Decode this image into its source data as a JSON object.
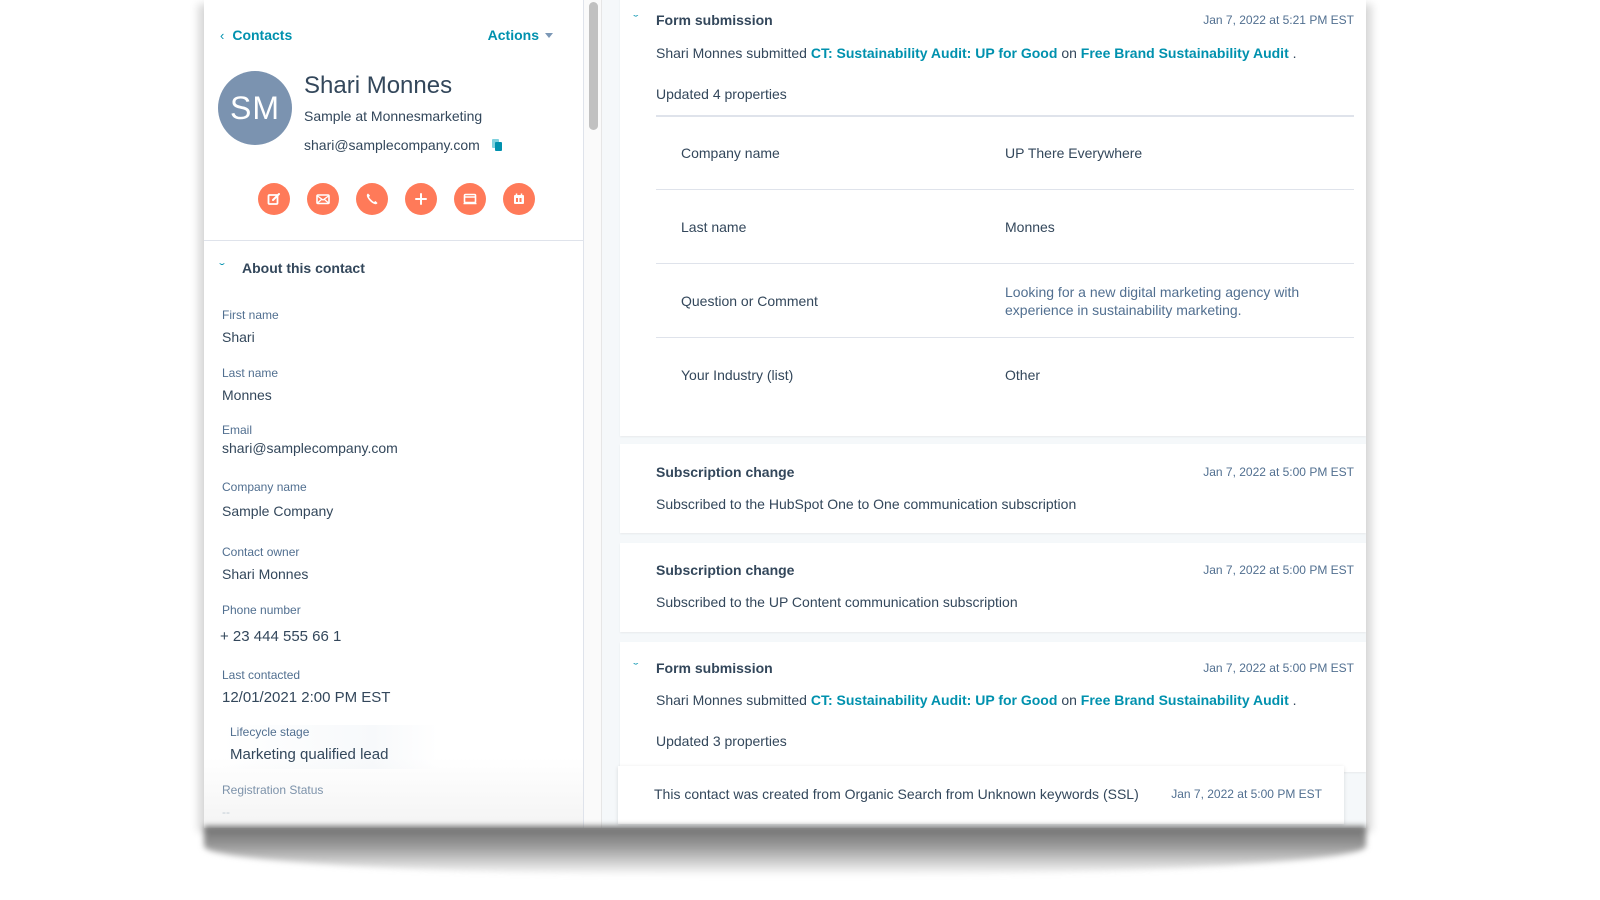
{
  "topbar": {
    "back_label": "Contacts",
    "actions_label": "Actions"
  },
  "contact": {
    "initials": "SM",
    "name": "Shari Monnes",
    "title": "Sample at Monnesmarketing",
    "email": "shari@samplecompany.com",
    "avatar_color": "#7b93b0"
  },
  "action_buttons": [
    {
      "name": "note",
      "icon": "edit-icon"
    },
    {
      "name": "email",
      "icon": "email-icon"
    },
    {
      "name": "call",
      "icon": "phone-icon"
    },
    {
      "name": "log",
      "icon": "plus-icon"
    },
    {
      "name": "task",
      "icon": "screen-icon"
    },
    {
      "name": "meeting",
      "icon": "calendar-icon"
    }
  ],
  "about": {
    "title": "About this contact",
    "properties": [
      {
        "label": "First name",
        "value": "Shari"
      },
      {
        "label": "Last name",
        "value": "Monnes"
      },
      {
        "label": "Email",
        "value": "shari@samplecompany.com"
      },
      {
        "label": "Company name",
        "value": "Sample Company"
      },
      {
        "label": "Contact owner",
        "value": "Shari Monnes"
      },
      {
        "label": "Phone number",
        "value": "+ 23 444 555 66 1"
      },
      {
        "label": "Last contacted",
        "value": "12/01/2021 2:00 PM EST"
      },
      {
        "label": "Lifecycle stage",
        "value": "Marketing qualified lead"
      },
      {
        "label": "Registration Status",
        "value": "--"
      }
    ]
  },
  "timeline": {
    "form1": {
      "title": "Form submission",
      "timestamp": "Jan 7, 2022 at 5:21 PM EST",
      "submitter": "Shari Monnes submitted",
      "form_link": "CT: Sustainability Audit: UP for Good",
      "on": "on",
      "page_link": "Free Brand Sustainability Audit",
      "period": ".",
      "updated": "Updated 4 properties",
      "properties": [
        {
          "key": "Company name",
          "value": "UP There Everywhere"
        },
        {
          "key": "Last name",
          "value": "Monnes"
        },
        {
          "key": "Question or Comment",
          "value": "Looking for a new digital marketing agency with experience in sustainability marketing."
        },
        {
          "key": "Your Industry (list)",
          "value": "Other"
        }
      ]
    },
    "sub1": {
      "title": "Subscription change",
      "timestamp": "Jan 7, 2022 at 5:00 PM EST",
      "body": "Subscribed to the HubSpot One to One communication subscription"
    },
    "sub2": {
      "title": "Subscription change",
      "timestamp": "Jan 7, 2022 at 5:00 PM EST",
      "body": "Subscribed to the UP Content communication subscription"
    },
    "form2": {
      "title": "Form submission",
      "timestamp": "Jan 7, 2022 at 5:00 PM EST",
      "submitter": "Shari Monnes submitted",
      "form_link": "CT: Sustainability Audit: UP for Good",
      "on": "on",
      "page_link": "Free Brand Sustainability Audit",
      "period": ".",
      "updated": "Updated 3 properties"
    },
    "created": {
      "body": "This contact was created from Organic Search from Unknown keywords (SSL)",
      "timestamp": "Jan 7, 2022 at 5:00 PM EST"
    }
  },
  "colors": {
    "accent": "#0091ae",
    "action_button": "#ff7a59",
    "text": "#33475b",
    "label": "#516f90"
  }
}
